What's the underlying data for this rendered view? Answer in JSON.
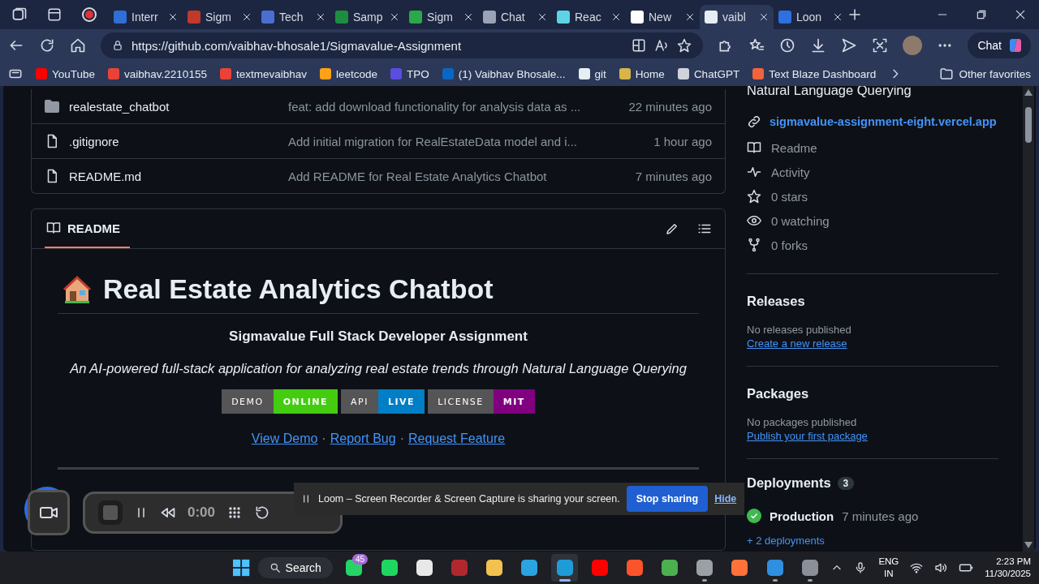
{
  "browser": {
    "tabs": [
      {
        "title": "Interr",
        "color": "#2f6fd6",
        "selected": false
      },
      {
        "title": "Sigm",
        "color": "#c0392b",
        "selected": false
      },
      {
        "title": "Tech",
        "color": "#4a6fd1",
        "selected": false
      },
      {
        "title": "Samp",
        "color": "#1e8e3e",
        "selected": false
      },
      {
        "title": "Sigm",
        "color": "#2aa84a",
        "selected": false
      },
      {
        "title": "Chat",
        "color": "#9aa3b5",
        "selected": false
      },
      {
        "title": "Reac",
        "color": "#5fd3e6",
        "selected": false
      },
      {
        "title": "New",
        "color": "#ffffff",
        "selected": false
      },
      {
        "title": "vaibl",
        "color": "#e6edf3",
        "selected": true
      },
      {
        "title": "Loon",
        "color": "#2f6fe0",
        "selected": false
      }
    ],
    "url": "https://github.com/vaibhav-bhosale1/Sigmavalue-Assignment",
    "chat_button": "Chat",
    "bookmarks": [
      {
        "label": "YouTube",
        "color": "#ff0000"
      },
      {
        "label": "vaibhav.2210155",
        "color": "#ea4335"
      },
      {
        "label": "textmevaibhav",
        "color": "#ea4335"
      },
      {
        "label": "leetcode",
        "color": "#ffa116"
      },
      {
        "label": "TPO",
        "color": "#5b4de0"
      },
      {
        "label": "(1) Vaibhav Bhosale...",
        "color": "#0a66c2"
      },
      {
        "label": "git",
        "color": "#e6edf3"
      },
      {
        "label": "Home",
        "color": "#d8b44a"
      },
      {
        "label": "ChatGPT",
        "color": "#cfd3da"
      },
      {
        "label": "Text Blaze Dashboard",
        "color": "#f0643c"
      }
    ],
    "other_favorites": "Other favorites"
  },
  "files": [
    {
      "kind": "folder",
      "name": "realestate_chatbot",
      "message": "feat: add download functionality for analysis data as ...",
      "time": "22 minutes ago"
    },
    {
      "kind": "file",
      "name": ".gitignore",
      "message": "Add initial migration for RealEstateData model and i...",
      "time": "1 hour ago"
    },
    {
      "kind": "file",
      "name": "README.md",
      "message": "Add README for Real Estate Analytics Chatbot",
      "time": "7 minutes ago"
    }
  ],
  "readme": {
    "tab": "README",
    "title": "Real Estate Analytics Chatbot",
    "subtitle": "Sigmavalue Full Stack Developer Assignment",
    "tagline": "An AI-powered full-stack application for analyzing real estate trends through Natural Language Querying",
    "badges": [
      {
        "label": "DEMO",
        "value": "ONLINE",
        "color": "#44cc11"
      },
      {
        "label": "API",
        "value": "LIVE",
        "color": "#007ec6"
      },
      {
        "label": "LICENSE",
        "value": "MIT",
        "color": "#800080"
      }
    ],
    "links": [
      {
        "text": "View Demo"
      },
      {
        "text": "Report Bug"
      },
      {
        "text": "Request Feature"
      }
    ],
    "separator": "·"
  },
  "sidebar": {
    "about_tail": "Natural Language Querying",
    "website": "sigmavalue-assignment-eight.vercel.app",
    "stats": [
      {
        "kind": "book",
        "label": "Readme"
      },
      {
        "kind": "pulse",
        "label": "Activity"
      },
      {
        "kind": "star",
        "label": "0 stars"
      },
      {
        "kind": "eye",
        "label": "0 watching"
      },
      {
        "kind": "fork",
        "label": "0 forks"
      }
    ],
    "releases": {
      "title": "Releases",
      "empty": "No releases published",
      "link": "Create a new release"
    },
    "packages": {
      "title": "Packages",
      "empty": "No packages published",
      "link": "Publish your first package"
    },
    "deployments": {
      "title": "Deployments",
      "count": "3",
      "items": [
        {
          "name": "Production",
          "time": "7 minutes ago"
        }
      ],
      "more": "+ 2 deployments"
    }
  },
  "loom": {
    "timer": "0:00",
    "message": "Loom – Screen Recorder & Screen Capture is sharing your screen.",
    "stop": "Stop sharing",
    "hide": "Hide"
  },
  "taskbar": {
    "search": "Search",
    "whatsapp_badge": "45",
    "language": "ENG",
    "region": "IN",
    "time": "2:23 PM",
    "date": "11/30/2025",
    "apps": [
      {
        "color": "#25d366",
        "running": false,
        "selected": false
      },
      {
        "color": "#1ed760",
        "running": false,
        "selected": false
      },
      {
        "color": "#e8e8e8",
        "running": false,
        "selected": false
      },
      {
        "color": "#b0282d",
        "running": false,
        "selected": false
      },
      {
        "color": "#f2c14e",
        "running": false,
        "selected": false
      },
      {
        "color": "#2aa3e0",
        "running": false,
        "selected": false
      },
      {
        "color": "#1f9bd8",
        "running": true,
        "selected": true
      },
      {
        "color": "#ff0000",
        "running": false,
        "selected": false
      },
      {
        "color": "#fb542b",
        "running": false,
        "selected": false
      },
      {
        "color": "#4caf50",
        "running": false,
        "selected": false
      },
      {
        "color": "#9aa0a6",
        "running": true,
        "selected": false
      },
      {
        "color": "#ff7139",
        "running": false,
        "selected": false
      },
      {
        "color": "#2f8fe0",
        "running": true,
        "selected": false
      },
      {
        "color": "#8a8f98",
        "running": true,
        "selected": false
      }
    ]
  }
}
